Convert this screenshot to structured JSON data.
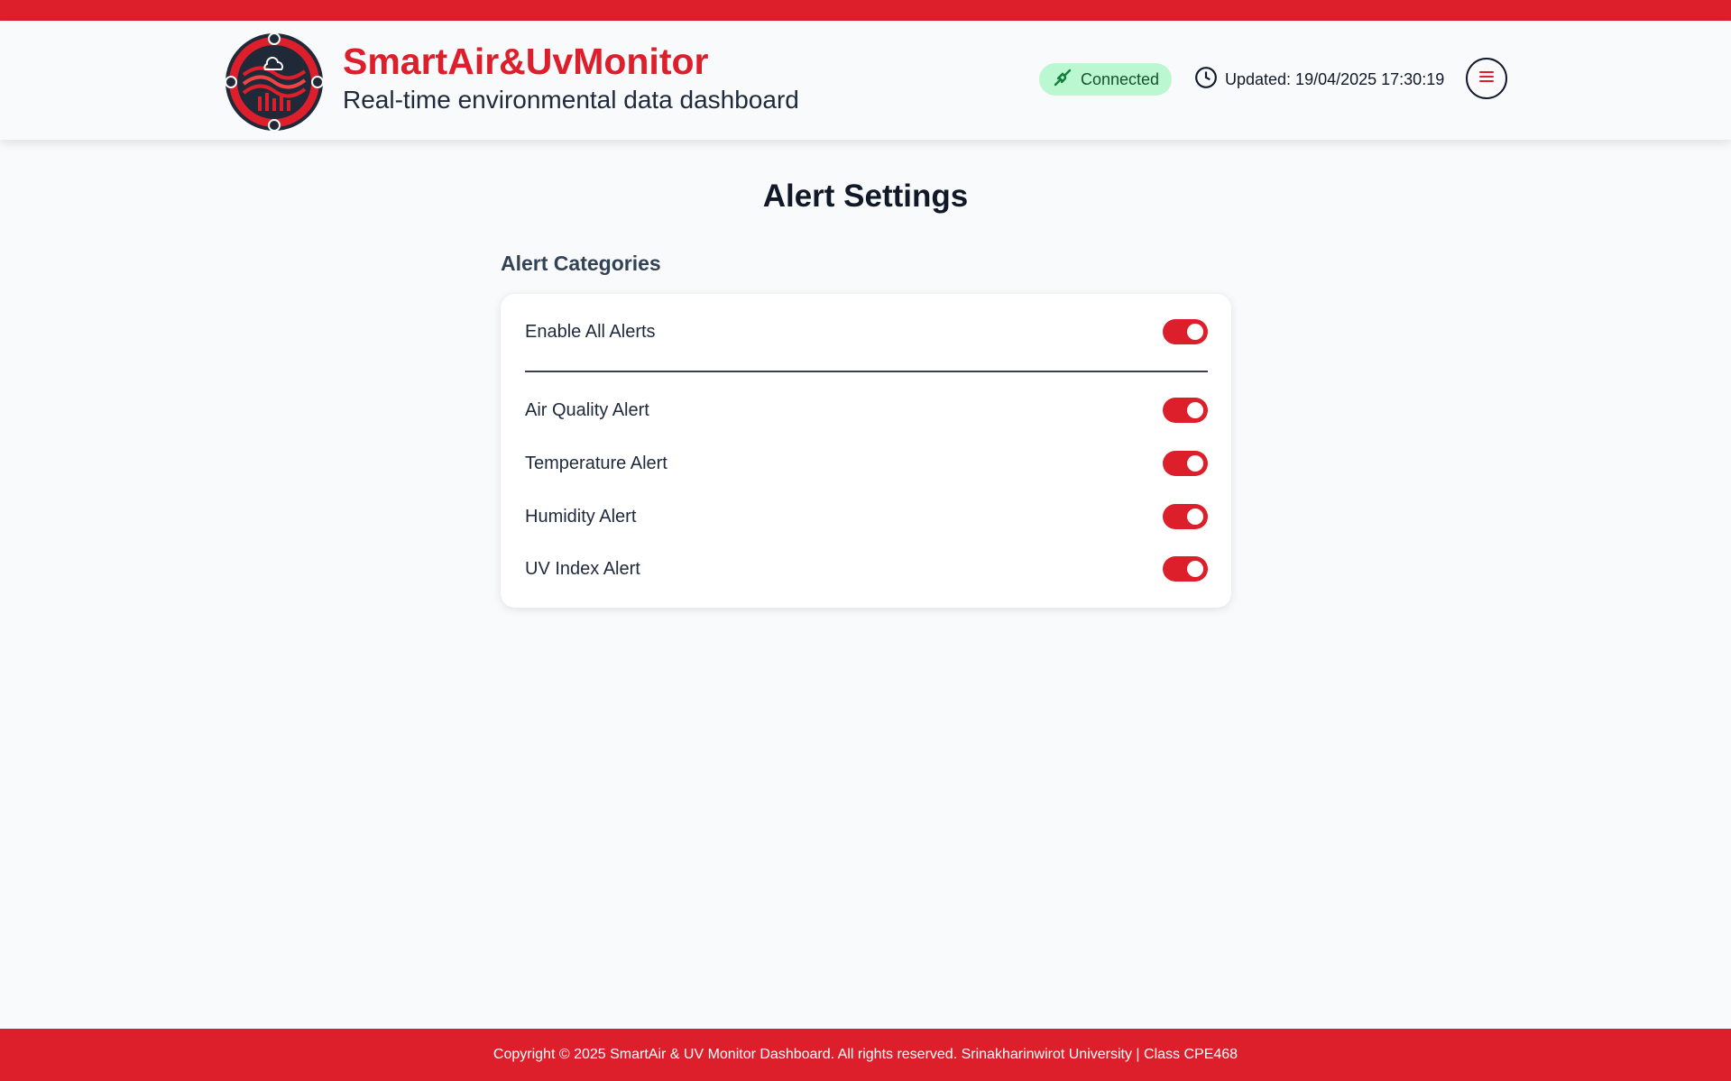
{
  "header": {
    "brand_title": "SmartAir&UvMonitor",
    "brand_subtitle": "Real-time environmental data dashboard",
    "status_label": "Connected",
    "updated_text": "Updated: 19/04/2025 17:30:19",
    "icons": {
      "logo": "smartair-logo",
      "status": "connection-plug-icon",
      "updated": "clock-icon",
      "menu": "hamburger-menu-icon"
    }
  },
  "main": {
    "page_title": "Alert Settings",
    "section_title": "Alert Categories",
    "master_toggle": {
      "label": "Enable All Alerts",
      "enabled": true
    },
    "alerts": [
      {
        "label": "Air Quality Alert",
        "enabled": true
      },
      {
        "label": "Temperature Alert",
        "enabled": true
      },
      {
        "label": "Humidity Alert",
        "enabled": true
      },
      {
        "label": "UV Index Alert",
        "enabled": true
      }
    ]
  },
  "footer": {
    "text": "Copyright © 2025 SmartAir & UV Monitor Dashboard. All rights reserved. Srinakharinwirot University | Class CPE468"
  },
  "colors": {
    "accent": "#dc1f2b",
    "status_bg": "#bbf7d0",
    "status_text": "#14532d",
    "background": "#f8fafc"
  }
}
